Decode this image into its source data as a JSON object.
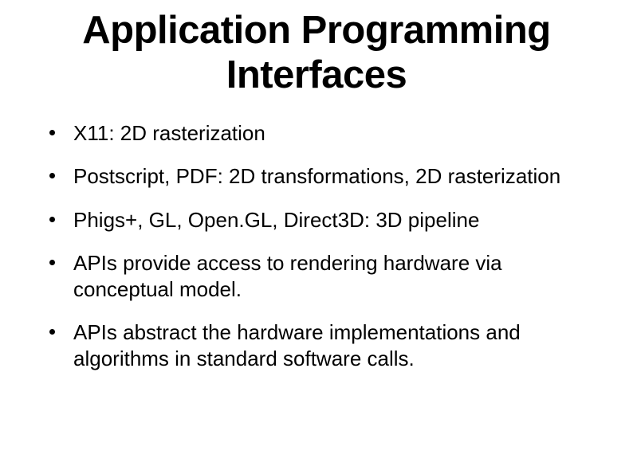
{
  "slide": {
    "title": "Application Programming Interfaces",
    "bullets": [
      "X11: 2D rasterization",
      "Postscript, PDF: 2D transformations, 2D rasterization",
      "Phigs+, GL, Open.GL, Direct3D: 3D pipeline",
      "APIs provide access to rendering hardware via conceptual model.",
      "APIs abstract the hardware implementations and algorithms in standard software calls."
    ]
  }
}
